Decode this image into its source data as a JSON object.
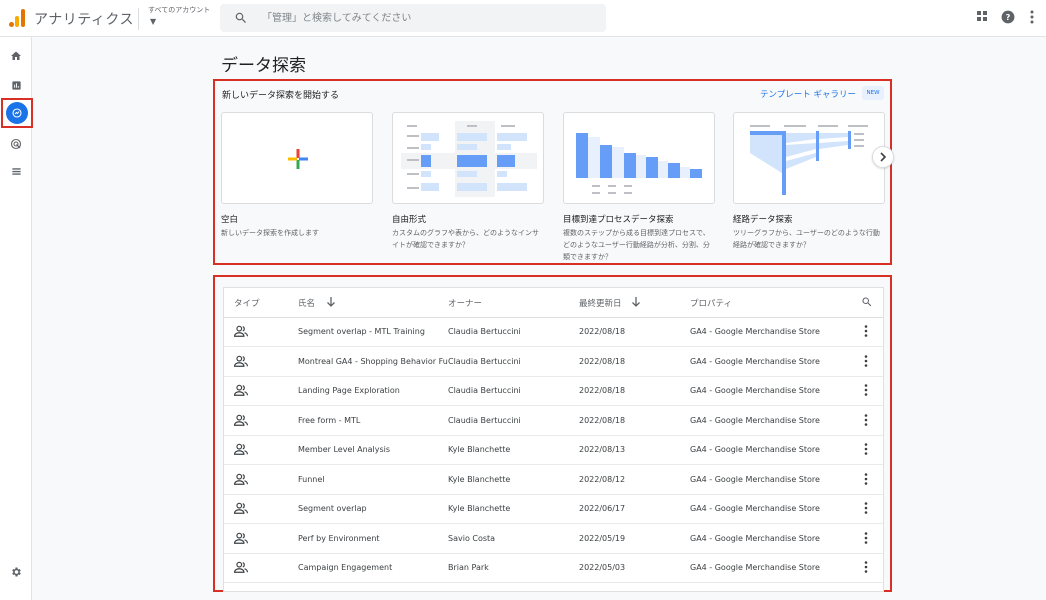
{
  "header": {
    "app_title": "アナリティクス",
    "account_label": "すべてのアカウント",
    "search_placeholder": "「管理」と検索してみてください"
  },
  "page": {
    "title": "データ探索"
  },
  "new_exploration": {
    "title": "新しいデータ探索を開始する",
    "gallery_label": "テンプレート ギャラリー",
    "new_badge": "NEW",
    "cards": [
      {
        "title": "空白",
        "desc": "新しいデータ探索を作成します"
      },
      {
        "title": "自由形式",
        "desc": "カスタムのグラフや表から、どのようなインサイトが確認できますか？"
      },
      {
        "title": "目標到達プロセスデータ探索",
        "desc": "複数のステップから成る目標到達プロセスで、どのようなユーザー行動経路が分析、分割、分類できますか？"
      },
      {
        "title": "経路データ探索",
        "desc": "ツリーグラフから、ユーザーのどのような行動経路が確認できますか？"
      }
    ]
  },
  "table": {
    "columns": {
      "type": "タイプ",
      "name": "氏名",
      "owner": "オーナー",
      "modified": "最終更新日",
      "property": "プロパティ"
    },
    "rows": [
      {
        "name": "Segment overlap - MTL Training",
        "owner": "Claudia Bertuccini",
        "date": "2022/08/18",
        "property": "GA4 - Google Merchandise Store"
      },
      {
        "name": "Montreal GA4 - Shopping Behavior Fu...",
        "owner": "Claudia Bertuccini",
        "date": "2022/08/18",
        "property": "GA4 - Google Merchandise Store"
      },
      {
        "name": "Landing Page Exploration",
        "owner": "Claudia Bertuccini",
        "date": "2022/08/18",
        "property": "GA4 - Google Merchandise Store"
      },
      {
        "name": "Free form - MTL",
        "owner": "Claudia Bertuccini",
        "date": "2022/08/18",
        "property": "GA4 - Google Merchandise Store"
      },
      {
        "name": "Member Level Analysis",
        "owner": "Kyle Blanchette",
        "date": "2022/08/13",
        "property": "GA4 - Google Merchandise Store"
      },
      {
        "name": "Funnel",
        "owner": "Kyle Blanchette",
        "date": "2022/08/12",
        "property": "GA4 - Google Merchandise Store"
      },
      {
        "name": "Segment overlap",
        "owner": "Kyle Blanchette",
        "date": "2022/06/17",
        "property": "GA4 - Google Merchandise Store"
      },
      {
        "name": "Perf by Environment",
        "owner": "Savio Costa",
        "date": "2022/05/19",
        "property": "GA4 - Google Merchandise Store"
      },
      {
        "name": "Campaign Engagement",
        "owner": "Brian Park",
        "date": "2022/05/03",
        "property": "GA4 - Google Merchandise Store"
      }
    ]
  },
  "colors": {
    "accent": "#1a73e8",
    "highlight_border": "#d93025"
  }
}
